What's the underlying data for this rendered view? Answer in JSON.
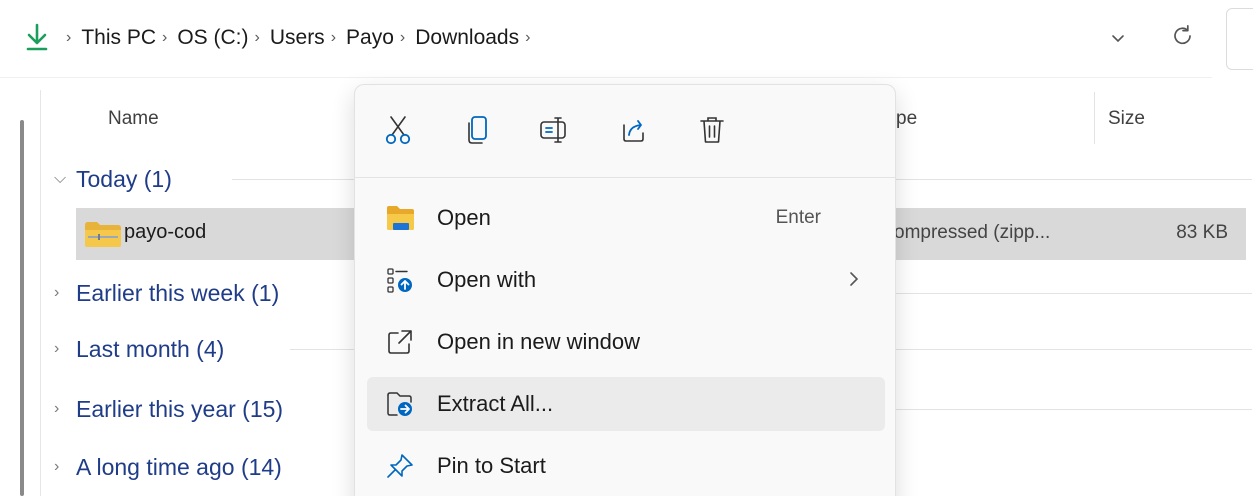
{
  "address_bar": {
    "breadcrumbs": [
      "This PC",
      "OS (C:)",
      "Users",
      "Payo",
      "Downloads"
    ],
    "separator": ">"
  },
  "columns": {
    "name": "Name",
    "type": "pe",
    "size": "Size"
  },
  "groups": [
    {
      "label": "Today (1)",
      "expanded": true
    },
    {
      "label": "Earlier this week (1)",
      "expanded": false
    },
    {
      "label": "Last month (4)",
      "expanded": false
    },
    {
      "label": "Earlier this year (15)",
      "expanded": false
    },
    {
      "label": "A long time ago (14)",
      "expanded": false
    }
  ],
  "file": {
    "name": "payo-cod",
    "type": "ompressed (zipp...",
    "size": "83 KB",
    "icon": "zip-folder-icon"
  },
  "context_menu": {
    "toolbar": [
      {
        "name": "cut",
        "icon": "scissors-icon"
      },
      {
        "name": "copy",
        "icon": "copy-icon"
      },
      {
        "name": "rename",
        "icon": "rename-icon"
      },
      {
        "name": "share",
        "icon": "share-icon"
      },
      {
        "name": "delete",
        "icon": "trash-icon"
      }
    ],
    "items": [
      {
        "label": "Open",
        "shortcut": "Enter",
        "icon": "folder-icon"
      },
      {
        "label": "Open with",
        "icon": "open-with-icon",
        "submenu": true
      },
      {
        "label": "Open in new window",
        "icon": "new-window-icon"
      },
      {
        "label": "Extract All...",
        "icon": "extract-icon",
        "highlighted": true
      },
      {
        "label": "Pin to Start",
        "icon": "pin-icon"
      }
    ]
  },
  "colors": {
    "accent": "#0067c0",
    "group_label": "#1f3c88",
    "selection": "#d9d9d9",
    "download_green": "#1a9e5b"
  }
}
